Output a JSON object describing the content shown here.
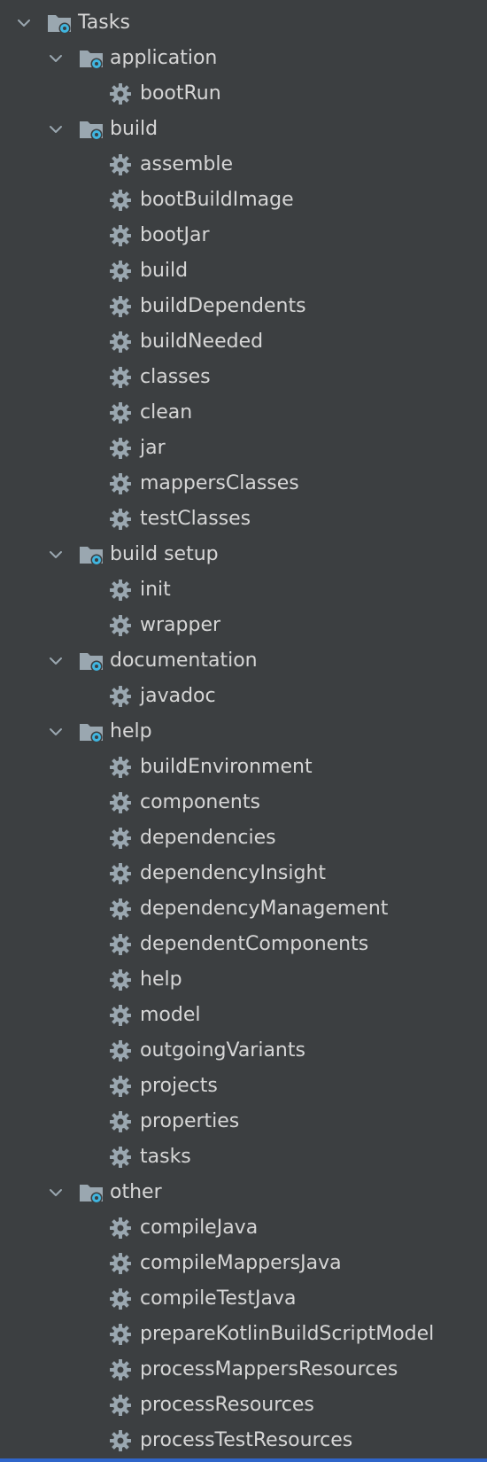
{
  "root": {
    "label": "Tasks",
    "icon": "task-folder-gear-icon",
    "expanded": true
  },
  "groups": [
    {
      "label": "application",
      "expanded": true,
      "tasks": [
        "bootRun"
      ]
    },
    {
      "label": "build",
      "expanded": true,
      "tasks": [
        "assemble",
        "bootBuildImage",
        "bootJar",
        "build",
        "buildDependents",
        "buildNeeded",
        "classes",
        "clean",
        "jar",
        "mappersClasses",
        "testClasses"
      ]
    },
    {
      "label": "build setup",
      "expanded": true,
      "tasks": [
        "init",
        "wrapper"
      ]
    },
    {
      "label": "documentation",
      "expanded": true,
      "tasks": [
        "javadoc"
      ]
    },
    {
      "label": "help",
      "expanded": true,
      "tasks": [
        "buildEnvironment",
        "components",
        "dependencies",
        "dependencyInsight",
        "dependencyManagement",
        "dependentComponents",
        "help",
        "model",
        "outgoingVariants",
        "projects",
        "properties",
        "tasks"
      ]
    },
    {
      "label": "other",
      "expanded": true,
      "tasks": [
        "compileJava",
        "compileMappersJava",
        "compileTestJava",
        "prepareKotlinBuildScriptModel",
        "processMappersResources",
        "processResources",
        "processTestResources"
      ]
    }
  ],
  "colors": {
    "background": "#3c3f41",
    "text": "#d6d6d6",
    "icon_gray": "#9aa7b0",
    "icon_accent": "#40b6e0",
    "selection_bar": "#2f65ca"
  },
  "icons": {
    "expand": "chevron-down-icon",
    "group": "task-folder-gear-icon",
    "task": "gear-icon"
  }
}
